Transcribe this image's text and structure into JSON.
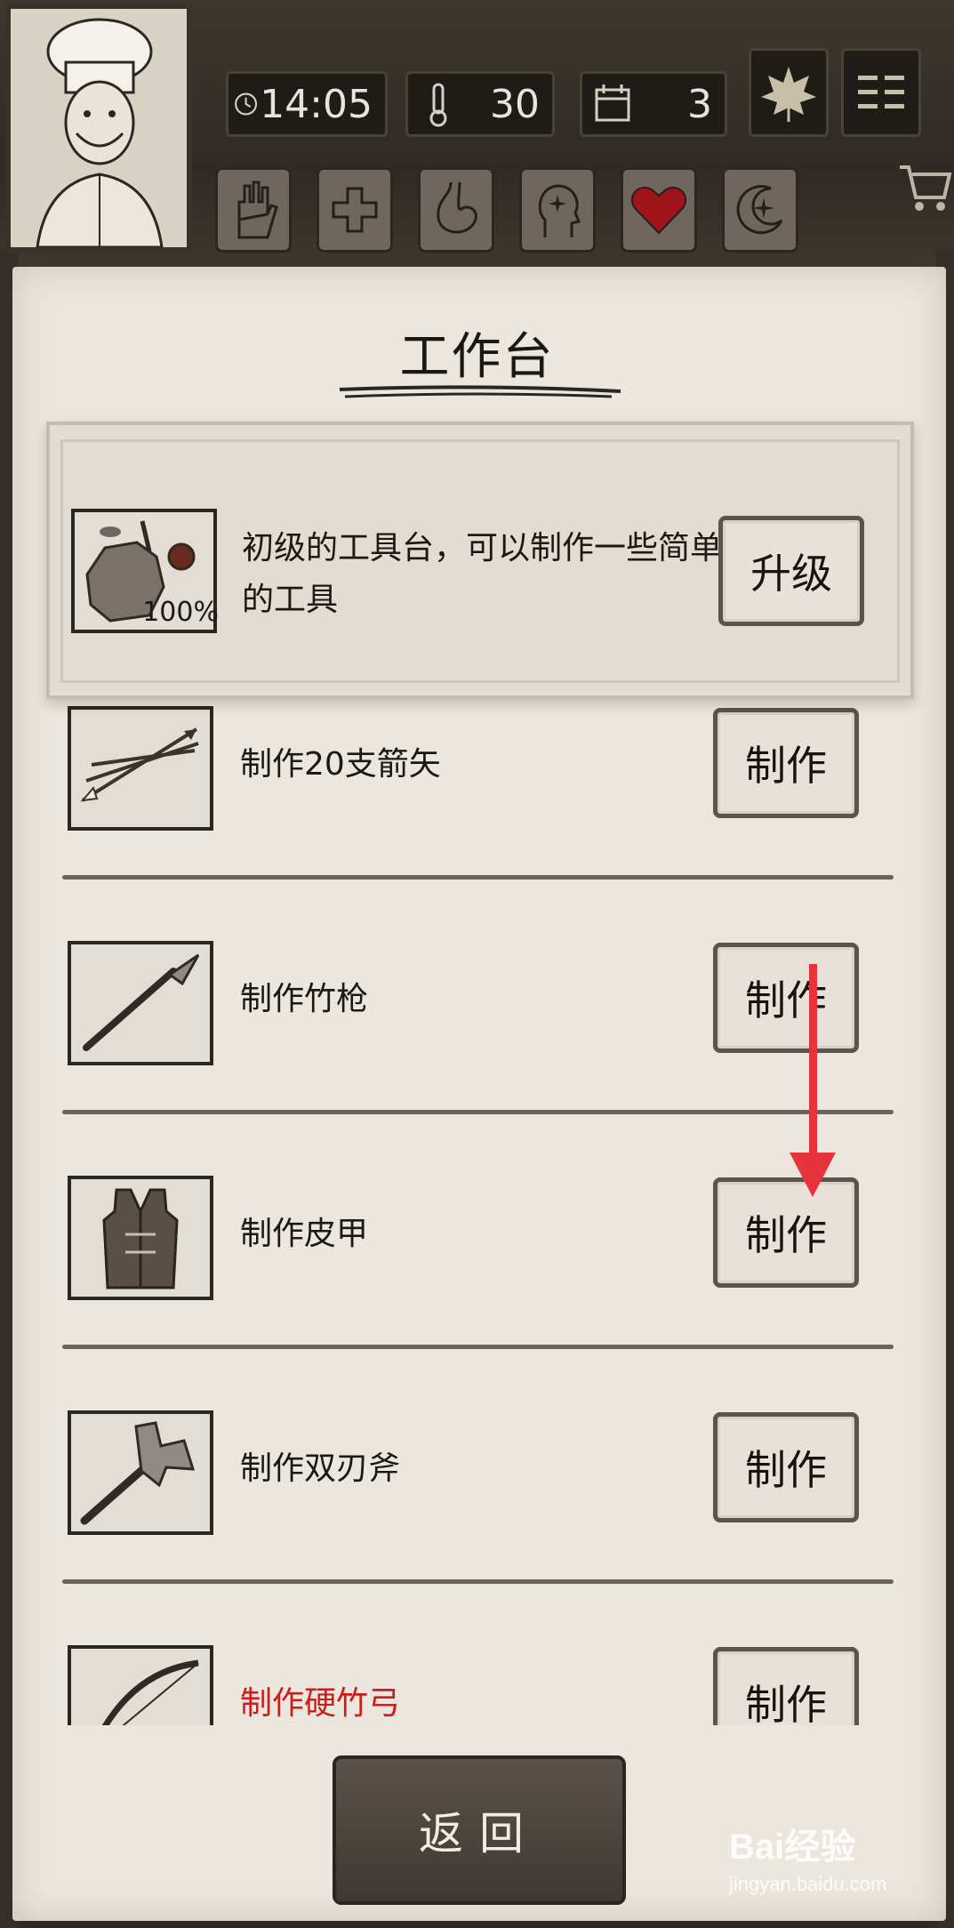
{
  "header": {
    "time": "14:05",
    "temperature": "30",
    "day": "3",
    "status_icons": [
      "hand-bandage-icon",
      "medical-cross-icon",
      "stomach-icon",
      "head-mind-icon",
      "heart-icon",
      "moon-star-icon"
    ]
  },
  "panel": {
    "title": "工作台"
  },
  "upgrade": {
    "progress": "100%",
    "description": "初级的工具台，可以制作一些简单的工具",
    "button_label": "升级"
  },
  "recipes": [
    {
      "label": "制作20支箭矢",
      "button": "制作",
      "icon": "arrows-icon",
      "available": true
    },
    {
      "label": "制作竹枪",
      "button": "制作",
      "icon": "bamboo-spear-icon",
      "available": true
    },
    {
      "label": "制作皮甲",
      "button": "制作",
      "icon": "leather-armor-icon",
      "available": true
    },
    {
      "label": "制作双刃斧",
      "button": "制作",
      "icon": "double-axe-icon",
      "available": true
    },
    {
      "label": "制作硬竹弓",
      "button": "制作",
      "icon": "bamboo-bow-icon",
      "available": false
    }
  ],
  "footer": {
    "back_label": "返回"
  },
  "watermark": {
    "logo": "Bai经验",
    "url": "jingyan.baidu.com"
  },
  "colors": {
    "parchment": "#ebe6de",
    "button_border": "#5a544d",
    "unavailable_text": "#cc1c1c",
    "annotation_arrow": "#e8323c"
  }
}
